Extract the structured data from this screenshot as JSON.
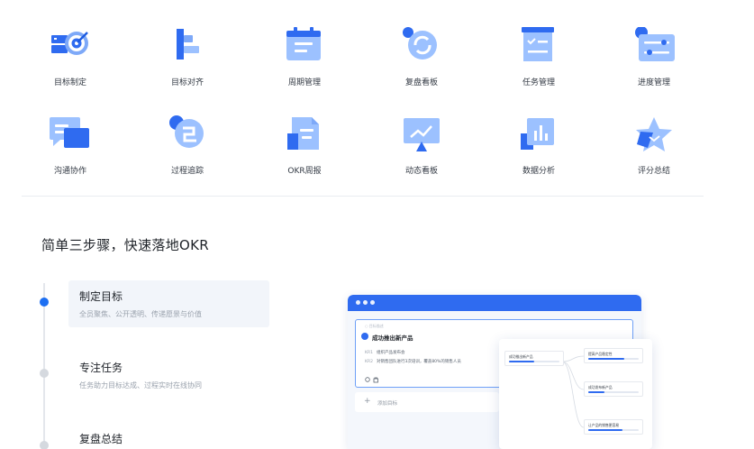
{
  "features": [
    {
      "label": "目标制定",
      "icon": "target-icon"
    },
    {
      "label": "目标对齐",
      "icon": "align-icon"
    },
    {
      "label": "周期管理",
      "icon": "calendar-icon"
    },
    {
      "label": "复盘看板",
      "icon": "refresh-icon"
    },
    {
      "label": "任务管理",
      "icon": "checklist-icon"
    },
    {
      "label": "进度管理",
      "icon": "progress-icon"
    },
    {
      "label": "沟通协作",
      "icon": "chat-icon"
    },
    {
      "label": "过程追踪",
      "icon": "tracking-icon"
    },
    {
      "label": "OKR周报",
      "icon": "report-icon"
    },
    {
      "label": "动态看板",
      "icon": "dashboard-icon"
    },
    {
      "label": "数据分析",
      "icon": "bar-chart-icon"
    },
    {
      "label": "评分总结",
      "icon": "star-icon"
    }
  ],
  "section": {
    "title": "简单三步骤，快速落地OKR"
  },
  "steps": [
    {
      "title": "制定目标",
      "desc": "全员聚焦、公开透明、传递愿景与价值",
      "active": true
    },
    {
      "title": "专注任务",
      "desc": "任务助力目标达成、过程实时在线协同",
      "active": false
    },
    {
      "title": "复盘总结",
      "desc": "",
      "active": false
    }
  ],
  "preview": {
    "hint": "○ 目标描述",
    "objective": "成功推出新产品",
    "krs": [
      {
        "tag": "KR1",
        "text": "组织产品发布会"
      },
      {
        "tag": "KR2",
        "text": "对销售团队进行3次培训，覆盖80%的销售人员"
      }
    ],
    "add_label": "添加目标",
    "tree": {
      "root": "成功推出新产品",
      "children": [
        "提高产品稳定性",
        "成功发布新产品",
        "让产品的销售更容易"
      ]
    }
  },
  "colors": {
    "accent": "#2f6bf0",
    "accent_light": "#9cc1ff"
  }
}
